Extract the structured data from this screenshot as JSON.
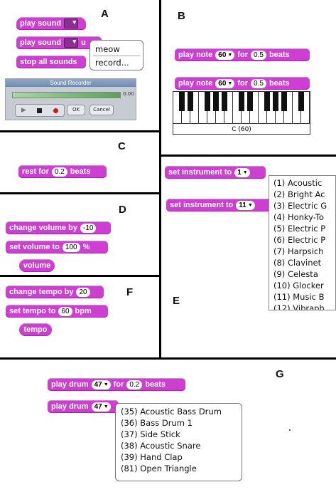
{
  "panels": {
    "A": "A",
    "B": "B",
    "C": "C",
    "D": "D",
    "E": "E",
    "F": "F",
    "G": "G"
  },
  "sound": {
    "play_sound": "play sound",
    "play_sound_2": "play sound",
    "until_done_partial": "u",
    "stop_all": "stop all sounds",
    "menu_items": [
      "meow",
      "record..."
    ]
  },
  "recorder": {
    "title": "Sound Recorder",
    "time": "0:00",
    "ok": "OK",
    "cancel": "Cancel"
  },
  "note": {
    "play_note": "play note",
    "note_value": "60",
    "for": "for",
    "beats_value": "0.5",
    "beats": "beats",
    "keyboard_label": "C (60)"
  },
  "rest": {
    "rest_for": "rest for",
    "beats_value": "0.2",
    "beats": "beats"
  },
  "volume": {
    "change_by": "change volume by",
    "change_value": "-10",
    "set_to": "set volume to",
    "set_value": "100",
    "percent": "%",
    "reporter": "volume"
  },
  "tempo": {
    "change_by": "change tempo by",
    "change_value": "20",
    "set_to": "set tempo to",
    "set_value": "60",
    "bpm": "bpm",
    "reporter": "tempo"
  },
  "instrument": {
    "label": "set instrument to",
    "value_1": "1",
    "value_2": "11",
    "options": [
      "(1) Acoustic",
      "(2) Bright Ac",
      "(3) Electric G",
      "(4) Honky-To",
      "(5) Electric P",
      "(6) Electric P",
      "(7) Harpsich",
      "(8) Clavinet",
      "(9) Celesta",
      "(10) Glocker",
      "(11) Music B",
      "(12) Vibraph"
    ]
  },
  "drum": {
    "play_drum": "play drum",
    "drum_value": "47",
    "for": "for",
    "beats_value": "0.2",
    "beats": "beats",
    "options": [
      "(35) Acoustic Bass Drum",
      "(36) Bass Drum 1",
      "(37) Side Stick",
      "(38) Acoustic Snare",
      "(39) Hand Clap",
      "(81) Open Triangle"
    ]
  },
  "colors": {
    "block": "#cc3fd0",
    "divider": "#000000"
  }
}
